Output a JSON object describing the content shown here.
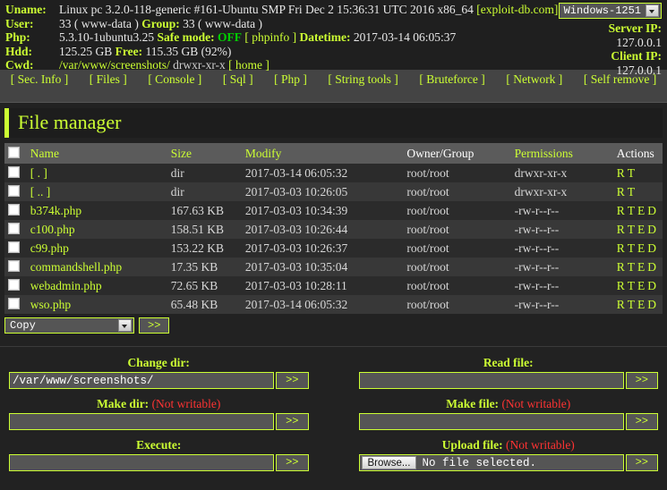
{
  "header": {
    "rows": [
      {
        "label": "Uname:",
        "value": "Linux pc 3.2.0-118-generic #161-Ubuntu SMP Fri Dec 2 15:36:31 UTC 2016 x86_64",
        "link": "[exploit-db.com]"
      }
    ],
    "uname_label": "Uname:",
    "uname_value": "Linux pc 3.2.0-118-generic #161-Ubuntu SMP Fri Dec 2 15:36:31 UTC 2016 x86_64",
    "uname_link": "[exploit-db.com]",
    "user_label": "User:",
    "user_value": "33 ( www-data )",
    "group_label": "Group:",
    "group_value": "33 ( www-data )",
    "php_label": "Php:",
    "php_value": "5.3.10-1ubuntu3.25",
    "safemode_label": "Safe mode:",
    "safemode_value": "OFF",
    "phpinfo_link": "[ phpinfo ]",
    "datetime_label": "Datetime:",
    "datetime_value": "2017-03-14 06:05:37",
    "hdd_label": "Hdd:",
    "hdd_value": "125.25 GB",
    "free_label": "Free:",
    "free_value": "115.35 GB (92%)",
    "cwd_label": "Cwd:",
    "cwd_value": "/var/www/screenshots/",
    "cwd_perms": "drwxr-xr-x",
    "home_link": "[ home ]",
    "charset": "Windows-1251",
    "server_ip_label": "Server IP:",
    "server_ip_value": "127.0.0.1",
    "client_ip_label": "Client IP:",
    "client_ip_value": "127.0.0.1"
  },
  "nav": [
    "[ Sec. Info ]",
    "[ Files ]",
    "[ Console ]",
    "[ Sql ]",
    "[ Php ]",
    "[ String tools ]",
    "[ Bruteforce ]",
    "[ Network ]",
    "[ Self remove ]"
  ],
  "page_title": "File manager",
  "table": {
    "headers": [
      "Name",
      "Size",
      "Modify",
      "Owner/Group",
      "Permissions",
      "Actions"
    ],
    "sortable": [
      true,
      true,
      true,
      false,
      true,
      false
    ],
    "rows": [
      {
        "name": "[ . ]",
        "size": "dir",
        "modify": "2017-03-14 06:05:32",
        "owner": "root/root",
        "perms": "drwxr-xr-x",
        "actions": [
          "R",
          "T"
        ]
      },
      {
        "name": "[ .. ]",
        "size": "dir",
        "modify": "2017-03-03 10:26:05",
        "owner": "root/root",
        "perms": "drwxr-xr-x",
        "actions": [
          "R",
          "T"
        ]
      },
      {
        "name": "b374k.php",
        "size": "167.63 KB",
        "modify": "2017-03-03 10:34:39",
        "owner": "root/root",
        "perms": "-rw-r--r--",
        "actions": [
          "R",
          "T",
          "E",
          "D"
        ]
      },
      {
        "name": "c100.php",
        "size": "158.51 KB",
        "modify": "2017-03-03 10:26:44",
        "owner": "root/root",
        "perms": "-rw-r--r--",
        "actions": [
          "R",
          "T",
          "E",
          "D"
        ]
      },
      {
        "name": "c99.php",
        "size": "153.22 KB",
        "modify": "2017-03-03 10:26:37",
        "owner": "root/root",
        "perms": "-rw-r--r--",
        "actions": [
          "R",
          "T",
          "E",
          "D"
        ]
      },
      {
        "name": "commandshell.php",
        "size": "17.35 KB",
        "modify": "2017-03-03 10:35:04",
        "owner": "root/root",
        "perms": "-rw-r--r--",
        "actions": [
          "R",
          "T",
          "E",
          "D"
        ]
      },
      {
        "name": "webadmin.php",
        "size": "72.65 KB",
        "modify": "2017-03-03 10:28:11",
        "owner": "root/root",
        "perms": "-rw-r--r--",
        "actions": [
          "R",
          "T",
          "E",
          "D"
        ]
      },
      {
        "name": "wso.php",
        "size": "65.48 KB",
        "modify": "2017-03-14 06:05:32",
        "owner": "root/root",
        "perms": "-rw-r--r--",
        "actions": [
          "R",
          "T",
          "E",
          "D"
        ]
      }
    ]
  },
  "bulk": {
    "selected": "Copy",
    "submit": ">>"
  },
  "forms": {
    "change_dir": {
      "label": "Change dir:",
      "value": "/var/www/screenshots/",
      "submit": ">>",
      "warn": ""
    },
    "read_file": {
      "label": "Read file:",
      "value": "",
      "submit": ">>",
      "warn": ""
    },
    "make_dir": {
      "label": "Make dir:",
      "value": "",
      "submit": ">>",
      "warn": "(Not writable)"
    },
    "make_file": {
      "label": "Make file:",
      "value": "",
      "submit": ">>",
      "warn": "(Not writable)"
    },
    "execute": {
      "label": "Execute:",
      "value": "",
      "submit": ">>",
      "warn": ""
    },
    "upload_file": {
      "label": "Upload file:",
      "browse": "Browse...",
      "file_status": "No file selected.",
      "submit": ">>",
      "warn": "(Not writable)"
    }
  },
  "colors": {
    "accent": "#ccff33",
    "warning": "#ff3333",
    "safemode_off": "#00d000",
    "page_bg": "#222222",
    "nav_bg": "#444444",
    "row_odd": "#2b2b2b",
    "row_even": "#383838",
    "header_row": "#5b5b5b"
  }
}
